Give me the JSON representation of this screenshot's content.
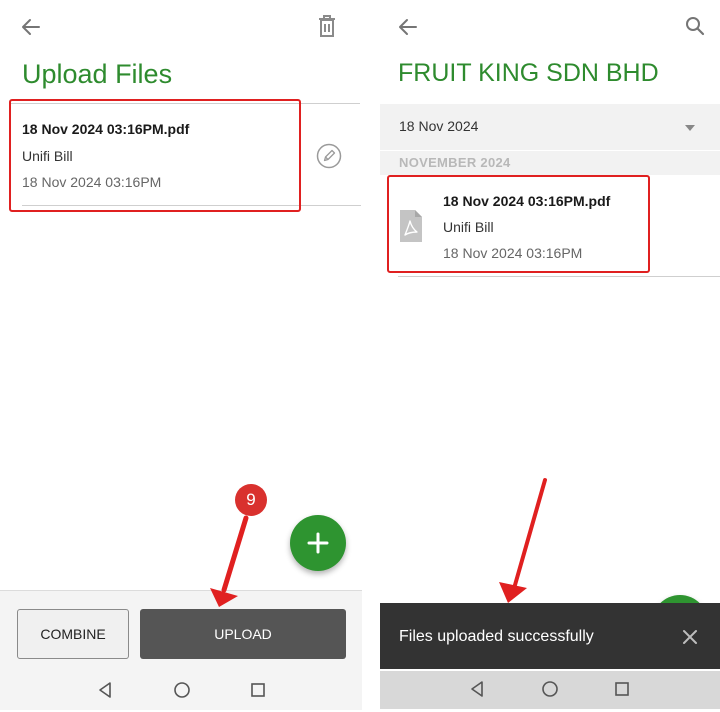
{
  "left_screen": {
    "title": "Upload Files",
    "back_icon": "arrow-left-icon",
    "delete_icon": "trash-icon",
    "file": {
      "name": "18 Nov 2024 03:16PM.pdf",
      "description": "Unifi Bill",
      "date": "18 Nov 2024 03:16PM",
      "edit_icon": "pencil-circle-icon"
    },
    "fab_icon": "plus-icon",
    "step_badge": "9",
    "buttons": {
      "combine": "COMBINE",
      "upload": "UPLOAD"
    }
  },
  "right_screen": {
    "title": "FRUIT KING SDN BHD",
    "back_icon": "arrow-left-icon",
    "search_icon": "search-icon",
    "date_filter": {
      "value": "18 Nov 2024",
      "dropdown_icon": "caret-down-icon"
    },
    "section_header": "NOVEMBER 2024",
    "file": {
      "name": "18 Nov 2024 03:16PM.pdf",
      "description": "Unifi Bill",
      "date": "18 Nov 2024 03:16PM",
      "file_icon": "pdf-file-icon"
    },
    "snackbar": {
      "message": "Files uploaded successfully",
      "close_icon": "close-icon"
    }
  },
  "system_nav": {
    "back_icon": "triangle-back-icon",
    "home_icon": "circle-home-icon",
    "recents_icon": "square-recents-icon"
  },
  "colors": {
    "brand_green": "#2e8b2e",
    "fab_green": "#2e9430",
    "highlight_red": "#e02020",
    "upload_button": "#555555",
    "snackbar": "#333333"
  }
}
